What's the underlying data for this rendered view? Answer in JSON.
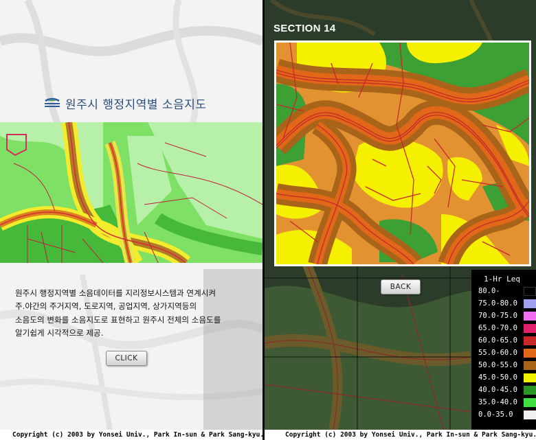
{
  "left_panel": {
    "title": "원주시 행정지역별 소음지도",
    "description_lines": [
      "원주시 행정지역별 소음데이터를 지리정보시스템과 연계시켜",
      "주.야간의 주거지역, 도로지역, 공업지역, 상가지역등의",
      "소음도의 변화를 소음지도로 표현하고 원주시 전체의 소음도를",
      "알기쉽게 시각적으로 제공."
    ],
    "click_label": "CLICK",
    "copyright": "Copyright (c) 2003 by Yonsei Univ., Park In-sun & Park Sang-kyu."
  },
  "right_panel": {
    "section_title": "SECTION 14",
    "back_label": "BACK",
    "copyright": "Copyright (c) 2003 by Yonsei Univ., Park In-sun & Park Sang-kyu."
  },
  "legend": {
    "title": "1-Hr Leq",
    "items": [
      {
        "label": "80.0-",
        "color": "#000000"
      },
      {
        "label": "75.0-80.0",
        "color": "#a0a0f0"
      },
      {
        "label": "70.0-75.0",
        "color": "#f070f0"
      },
      {
        "label": "65.0-70.0",
        "color": "#e0206a"
      },
      {
        "label": "60.0-65.0",
        "color": "#c82828"
      },
      {
        "label": "55.0-60.0",
        "color": "#e06818"
      },
      {
        "label": "50.0-55.0",
        "color": "#a86418"
      },
      {
        "label": "45.0-50.0",
        "color": "#f0f000"
      },
      {
        "label": "40.0-45.0",
        "color": "#2a9628"
      },
      {
        "label": "35.0-40.0",
        "color": "#40e040"
      },
      {
        "label": "0.0-35.0",
        "color": "#f0f0f0"
      }
    ]
  }
}
